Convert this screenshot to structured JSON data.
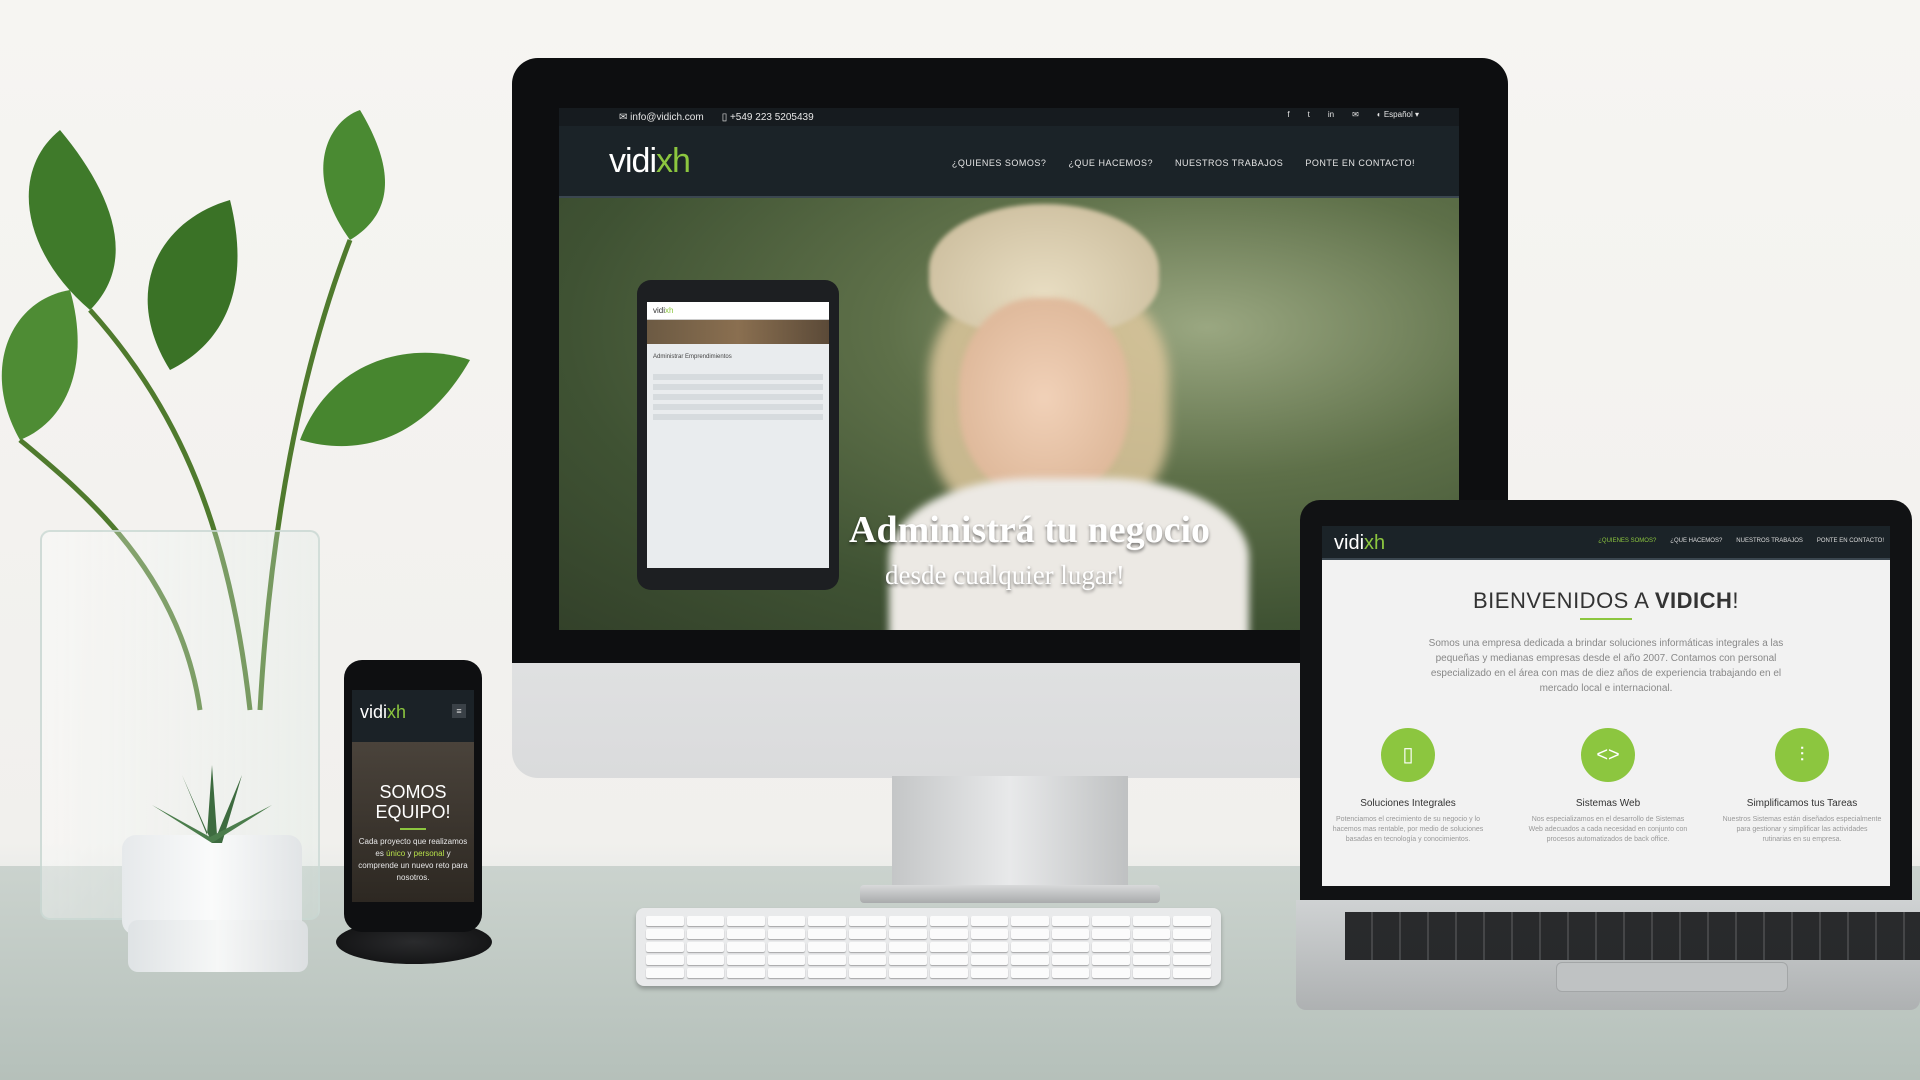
{
  "colors": {
    "accent": "#8cc63f",
    "nav_bg": "#1b2328"
  },
  "imac_site": {
    "topbar": {
      "email": "info@vidich.com",
      "phone": "+549 223 5205439",
      "language": "Español"
    },
    "logo": {
      "text_main": "vidi",
      "text_accent": "xh"
    },
    "nav": [
      "¿QUIENES SOMOS?",
      "¿QUE HACEMOS?",
      "NUESTROS TRABAJOS",
      "PONTE EN CONTACTO!"
    ],
    "hero_title": "Administrá tu negocio",
    "hero_subtitle": "desde cualquier lugar!",
    "tablet_label": "Administrar Emprendimientos"
  },
  "phone_site": {
    "logo": {
      "text_main": "vidi",
      "text_accent": "xh"
    },
    "menu_icon": "≡",
    "heading": "SOMOS EQUIPO!",
    "text_a": "Cada proyecto que realizamos es ",
    "text_hl1": "único",
    "text_b": " y ",
    "text_hl2": "personal",
    "text_c": " y comprende un nuevo reto para nosotros."
  },
  "laptop_site": {
    "logo": {
      "text_main": "vidi",
      "text_accent": "xh"
    },
    "nav": [
      "¿QUIENES SOMOS?",
      "¿QUE HACEMOS?",
      "NUESTROS TRABAJOS",
      "PONTE EN CONTACTO!"
    ],
    "title_prefix": "BIENVENIDOS A ",
    "title_bold": "VIDICH",
    "title_suffix": "!",
    "intro": "Somos una empresa dedicada a brindar soluciones informáticas integrales a las pequeñas y medianas empresas desde el año 2007. Contamos con personal especializado en el área con mas de diez años de experiencia trabajando en el mercado local e internacional.",
    "features": [
      {
        "icon": "tablet-icon",
        "glyph": "▯",
        "title": "Soluciones Integrales",
        "desc": "Potenciamos el crecimiento de su negocio y lo hacemos mas rentable, por medio de soluciones basadas en tecnología y conocimientos."
      },
      {
        "icon": "code-icon",
        "glyph": "<>",
        "title": "Sistemas Web",
        "desc": "Nos especializamos en el desarrollo de Sistemas Web adecuados a cada necesidad en conjunto con procesos automatizados de back office."
      },
      {
        "icon": "sliders-icon",
        "glyph": "⫶",
        "title": "Simplificamos tus Tareas",
        "desc": "Nuestros Sistemas están diseñados especialmente para gestionar y simplificar las actividades rutinarias en su empresa."
      }
    ]
  }
}
